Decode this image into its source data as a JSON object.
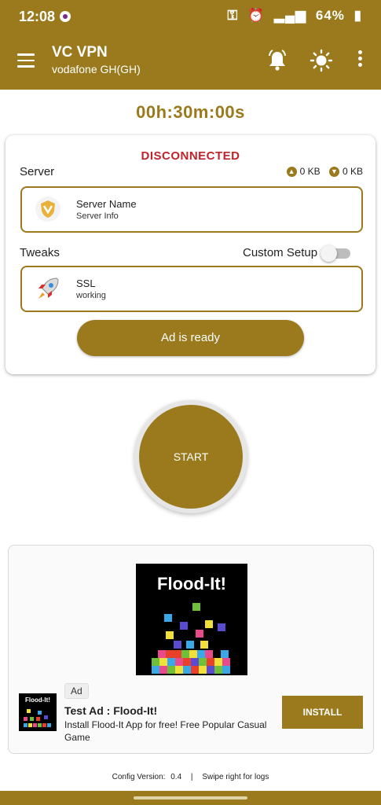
{
  "status_bar": {
    "time": "12:08",
    "battery": "64%"
  },
  "app_bar": {
    "title": "VC VPN",
    "subtitle": "vodafone GH(GH)",
    "icons": [
      "menu-icon",
      "bell-icon",
      "brightness-icon",
      "more-vert-icon"
    ]
  },
  "timer": "00h:30m:00s",
  "connection": {
    "status": "DISCONNECTED",
    "server_label": "Server",
    "upload": "0 KB",
    "download": "0 KB",
    "server": {
      "name": "Server Name",
      "info": "Server Info"
    },
    "tweaks_label": "Tweaks",
    "custom_setup_label": "Custom Setup",
    "custom_setup_enabled": false,
    "tweak": {
      "name": "SSL",
      "info": "working"
    },
    "ad_button": "Ad is ready"
  },
  "start_button": "START",
  "ad": {
    "image_title": "Flood-It!",
    "icon_title": "Flood-It!",
    "badge": "Ad",
    "title": "Test Ad : Flood-It!",
    "description": "Install Flood-It App for free! Free Popular Casual Game",
    "install_label": "INSTALL"
  },
  "footer": {
    "config_label": "Config Version:",
    "config_value": "0.4",
    "separator": "|",
    "hint": "Swipe right for logs"
  },
  "colors": {
    "primary": "#9a7a1c",
    "status_red": "#c0232b"
  }
}
